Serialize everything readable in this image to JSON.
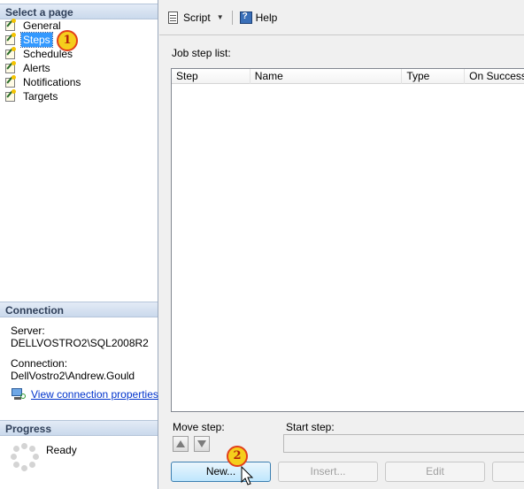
{
  "left": {
    "select_page_header": "Select a page",
    "pages": [
      {
        "label": "General",
        "selected": false
      },
      {
        "label": "Steps",
        "selected": true
      },
      {
        "label": "Schedules",
        "selected": false
      },
      {
        "label": "Alerts",
        "selected": false
      },
      {
        "label": "Notifications",
        "selected": false
      },
      {
        "label": "Targets",
        "selected": false
      }
    ],
    "connection_header": "Connection",
    "server_label": "Server:",
    "server_value": "DELLVOSTRO2\\SQL2008R2",
    "connection_label": "Connection:",
    "connection_value": "DellVostro2\\Andrew.Gould",
    "view_connection_link": "View connection properties",
    "progress_header": "Progress",
    "progress_status": "Ready"
  },
  "toolbar": {
    "script_label": "Script",
    "help_label": "Help"
  },
  "main": {
    "job_step_list_label": "Job step list:",
    "columns": [
      "Step",
      "Name",
      "Type",
      "On Success"
    ],
    "rows": [],
    "move_step_label": "Move step:",
    "start_step_label": "Start step:",
    "start_step_value": "",
    "buttons": {
      "new": "New...",
      "insert": "Insert...",
      "edit": "Edit",
      "delete": ""
    }
  },
  "callouts": {
    "one": "1",
    "two": "2"
  },
  "colors": {
    "selection": "#3399ff",
    "header_gradient_top": "#e3ebf6",
    "header_text": "#30405a",
    "link": "#0033cc",
    "callout_fill": "#f5ce1c",
    "callout_border": "#e2401a"
  }
}
